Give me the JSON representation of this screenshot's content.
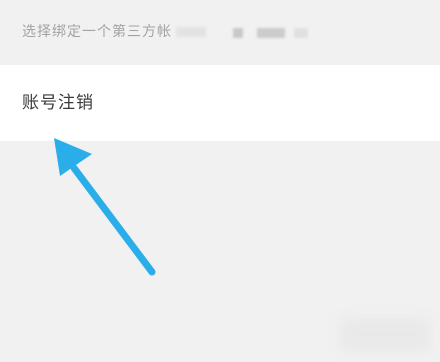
{
  "hint": {
    "text": "选择绑定一个第三方帐"
  },
  "account_cancel": {
    "label": "账号注销"
  },
  "colors": {
    "arrow": "#2aaeea",
    "row_background": "#ffffff",
    "page_background": "#f1f1f1"
  }
}
